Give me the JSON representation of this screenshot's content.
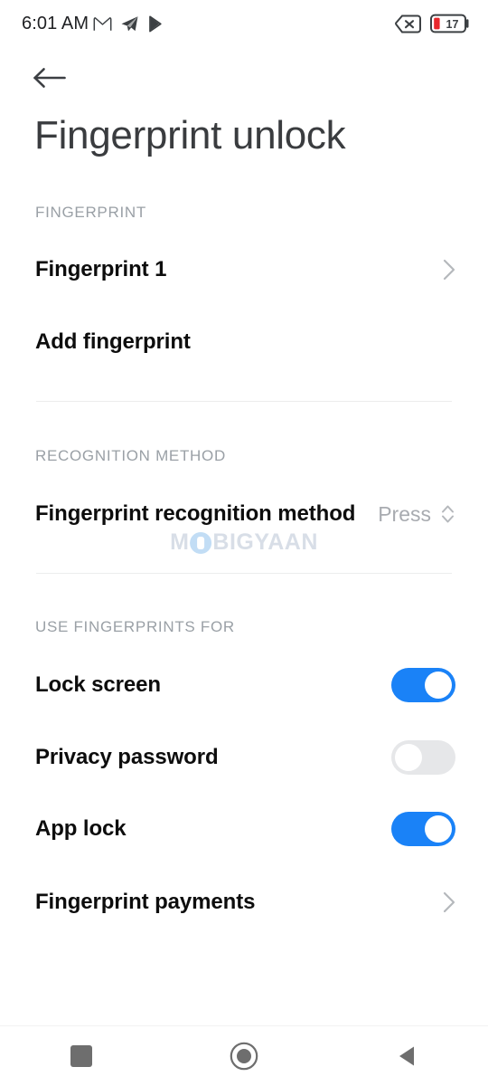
{
  "status_bar": {
    "time": "6:01 AM",
    "left_icons": [
      {
        "name": "gmail-icon",
        "label": "M"
      },
      {
        "name": "telegram-icon",
        "label": "send"
      },
      {
        "name": "play-store-icon",
        "label": "play"
      }
    ],
    "right_icons": [
      {
        "name": "no-sim-icon",
        "label": "x"
      }
    ],
    "battery": {
      "level_text": "17",
      "level_percent": 17,
      "color": "#e8282c"
    }
  },
  "nav": {
    "back_label": "Back"
  },
  "header": {
    "title": "Fingerprint unlock"
  },
  "sections": [
    {
      "id": "fingerprint",
      "header": "FINGERPRINT",
      "rows": [
        {
          "name": "row-fingerprint-1",
          "label": "Fingerprint 1",
          "accessory": "chevron"
        },
        {
          "name": "row-add-fingerprint",
          "label": "Add fingerprint",
          "accessory": "none"
        }
      ]
    },
    {
      "id": "recognition-method",
      "header": "RECOGNITION METHOD",
      "rows": [
        {
          "name": "row-fingerprint-recognition-method",
          "label": "Fingerprint recognition method",
          "value": "Press",
          "accessory": "stepper"
        }
      ]
    },
    {
      "id": "use-fingerprints-for",
      "header": "USE FINGERPRINTS FOR",
      "rows": [
        {
          "name": "row-lock-screen",
          "label": "Lock screen",
          "accessory": "toggle",
          "toggle_on": true
        },
        {
          "name": "row-privacy-password",
          "label": "Privacy password",
          "accessory": "toggle",
          "toggle_on": false
        },
        {
          "name": "row-app-lock",
          "label": "App lock",
          "accessory": "toggle",
          "toggle_on": true
        },
        {
          "name": "row-fingerprint-payments",
          "label": "Fingerprint payments",
          "accessory": "chevron"
        }
      ]
    }
  ],
  "watermark": {
    "prefix": "M",
    "suffix": "BIGYAAN"
  },
  "system_nav": {
    "recents_label": "Recents",
    "home_label": "Home",
    "back_label": "Back"
  },
  "colors": {
    "toggle_on": "#1a82f7",
    "toggle_off": "#e6e7e9",
    "section_header": "#9aa0a6",
    "row_label": "#0d0d0d",
    "title": "#3a3c3f"
  }
}
